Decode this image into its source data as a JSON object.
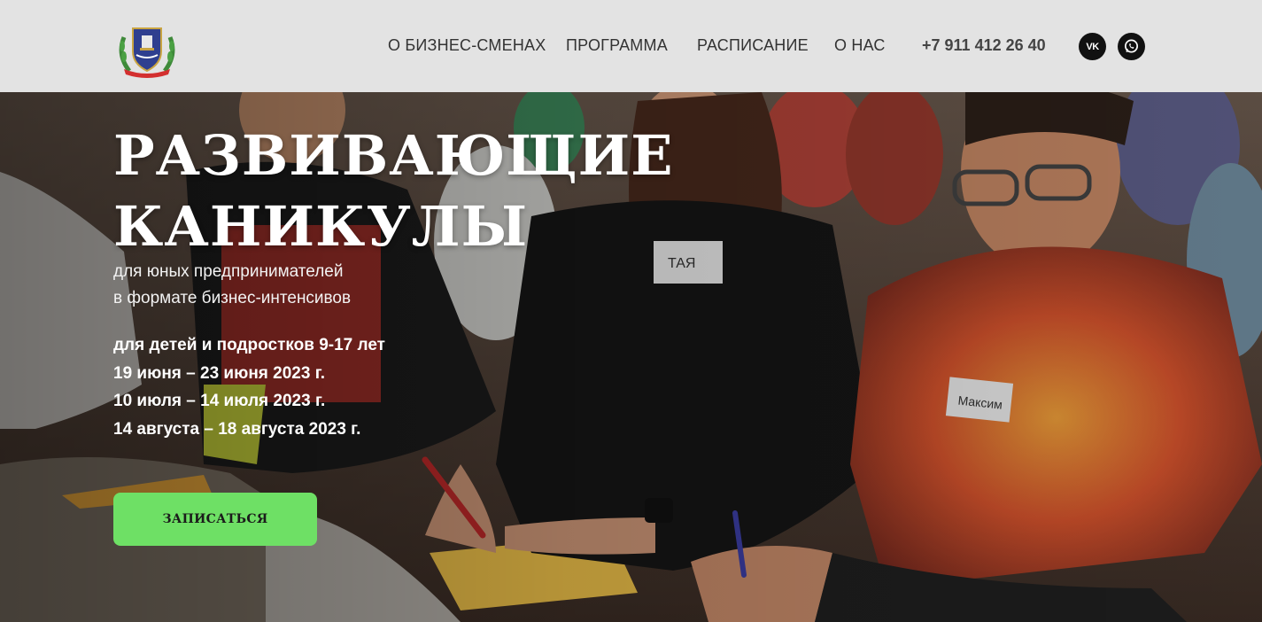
{
  "header": {
    "logo_icon": "school-shield-emblem-icon",
    "nav": [
      {
        "label": "О БИЗНЕС-СМЕНАХ"
      },
      {
        "label": "ПРОГРАММА"
      },
      {
        "label": "РАСПИСАНИЕ"
      },
      {
        "label": "О НАС"
      }
    ],
    "phone": "+7 911 412 26 40",
    "social": [
      {
        "icon": "vk-icon",
        "label": "VK"
      },
      {
        "icon": "whatsapp-icon",
        "label": ""
      }
    ]
  },
  "hero": {
    "title_line1": "РАЗВИВАЮЩИЕ",
    "title_line2": "КАНИКУЛЫ",
    "subtitle_line1": "для юных предпринимателей",
    "subtitle_line2": "в формате бизнес-интенсивов",
    "details": [
      "для детей и подростков 9-17 лет",
      "19 июня – 23 июня 2023 г.",
      "10 июля – 14 июля 2023 г.",
      "14 августа – 18 августа 2023 г."
    ],
    "cta_label": "ЗАПИСАТЬСЯ",
    "background_image": "photo-of-teens-at-seminar-writing",
    "name_tags": [
      "ТАЯ",
      "Максим"
    ]
  },
  "colors": {
    "header_bg": "#e3e3e3",
    "nav_text": "#333333",
    "cta_bg": "#6ee065",
    "social_bg": "#111111"
  }
}
